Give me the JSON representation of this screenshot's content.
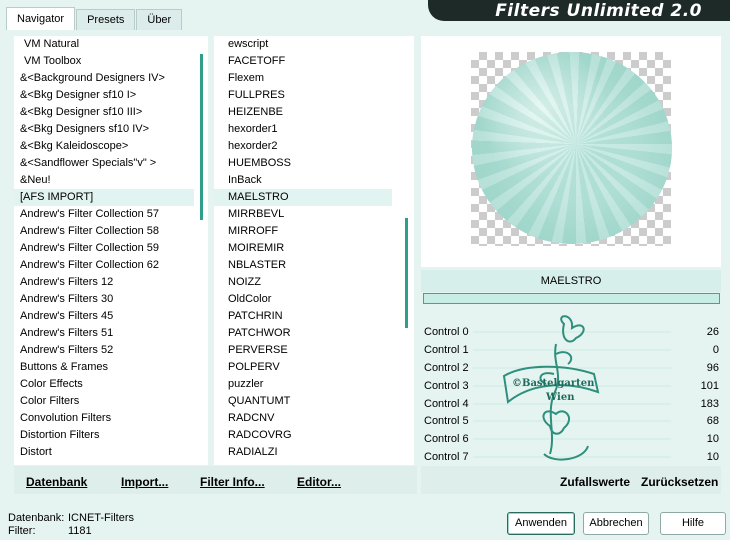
{
  "tabs": [
    "Navigator",
    "Presets",
    "Über"
  ],
  "active_tab": "Navigator",
  "app_title": "Filters Unlimited 2.0",
  "categories": {
    "items": [
      "VM Natural",
      "VM Toolbox",
      "&<Background Designers IV>",
      "&<Bkg Designer sf10 I>",
      "&<Bkg Designer sf10 III>",
      "&<Bkg Designers sf10 IV>",
      "&<Bkg Kaleidoscope>",
      "&<Sandflower Specials\"v\" >",
      "&Neu!",
      "[AFS IMPORT]",
      "Andrew's Filter Collection 57",
      "Andrew's Filter Collection 58",
      "Andrew's Filter Collection 59",
      "Andrew's Filter Collection 62",
      "Andrew's Filters 12",
      "Andrew's Filters 30",
      "Andrew's Filters 45",
      "Andrew's Filters 51",
      "Andrew's Filters 52",
      "Buttons & Frames",
      "Color Effects",
      "Color Filters",
      "Convolution Filters",
      "Distortion Filters",
      "Distort"
    ],
    "selected": "[AFS IMPORT]"
  },
  "filters": {
    "items": [
      "ewscript",
      "FACETOFF",
      "Flexem",
      "FULLPRES",
      "HEIZENBE",
      "hexorder1",
      "hexorder2",
      "HUEMBOSS",
      "InBack",
      "MAELSTRO",
      "MIRRBEVL",
      "MIRROFF",
      "MOIREMIR",
      "NBLASTER",
      "NOIZZ",
      "OldColor",
      "PATCHRIN",
      "PATCHWOR",
      "PERVERSE",
      "POLPERV",
      "puzzler",
      "QUANTUMT",
      "RADCNV",
      "RADCOVRG",
      "RADIALZI"
    ],
    "selected": "MAELSTRO"
  },
  "current_filter": "MAELSTRO",
  "controls": [
    {
      "label": "Control 0",
      "value": "26"
    },
    {
      "label": "Control 1",
      "value": "0"
    },
    {
      "label": "Control 2",
      "value": "96"
    },
    {
      "label": "Control 3",
      "value": "101"
    },
    {
      "label": "Control 4",
      "value": "183"
    },
    {
      "label": "Control 5",
      "value": "68"
    },
    {
      "label": "Control 6",
      "value": "10"
    },
    {
      "label": "Control 7",
      "value": "10"
    }
  ],
  "watermark": {
    "line1": "©Bastelgarten",
    "line2": "Wien"
  },
  "toolbar": {
    "datenbank": "Datenbank",
    "import": "Import...",
    "filter_info": "Filter Info...",
    "editor": "Editor...",
    "zufallswerte": "Zufallswerte",
    "zuruecksetzen": "Zurücksetzen"
  },
  "status": {
    "datenbank_key": "Datenbank:",
    "datenbank_value": "ICNET-Filters",
    "filter_key": "Filter:",
    "filter_value": "1181"
  },
  "buttons": {
    "anwenden": "Anwenden",
    "abbrechen": "Abbrechen",
    "hilfe": "Hilfe"
  },
  "colors": {
    "accent": "#2f9f8b",
    "background": "#e6f4f1",
    "banner": "#1e2a28",
    "orb": "#aadcd2"
  }
}
